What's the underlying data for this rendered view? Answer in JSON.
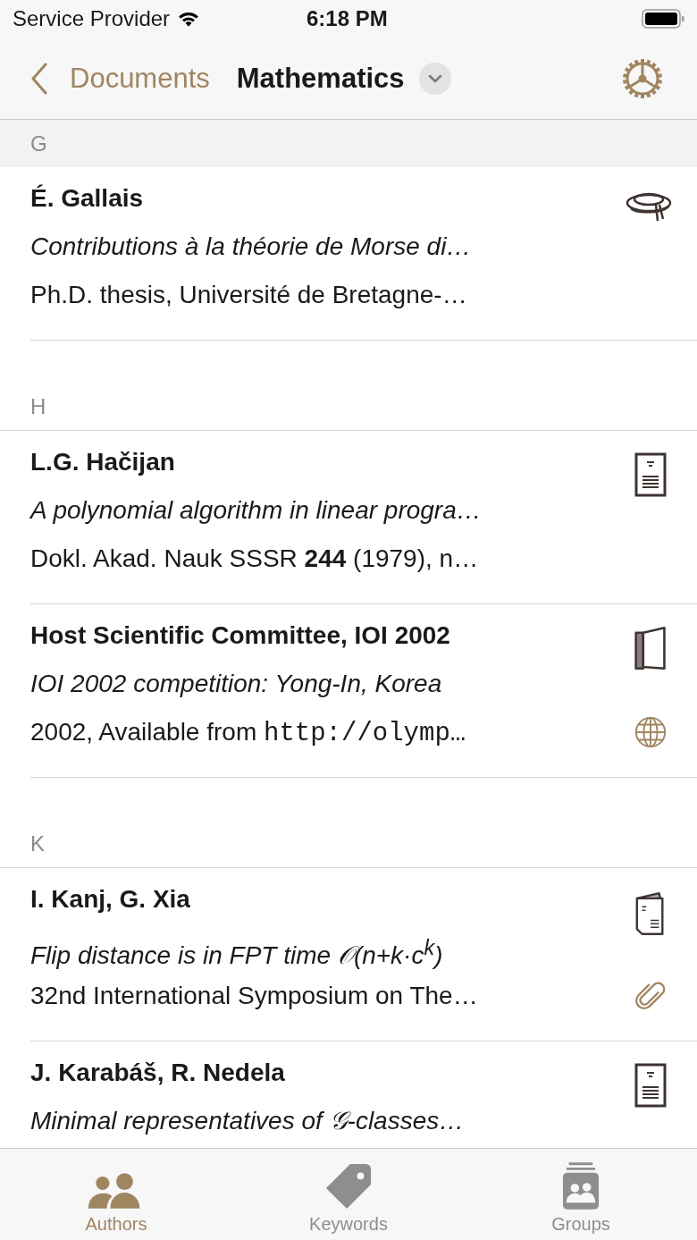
{
  "status_bar": {
    "carrier": "Service Provider",
    "time": "6:18 PM"
  },
  "nav": {
    "back": "Documents",
    "title": "Mathematics"
  },
  "sections": [
    {
      "letter": "G",
      "pinned": true,
      "rows": [
        {
          "author": "É. Gallais",
          "title": "Contributions à la théorie de Morse di…",
          "detail": [
            {
              "kind": "rich",
              "text": "Ph.D. thesis, Université de Bretagne-…"
            }
          ],
          "icons": [
            {
              "kind": "thesis"
            }
          ]
        }
      ]
    },
    {
      "letter": "H",
      "pinned": false,
      "rows": [
        {
          "author": "L.G. Hačijan",
          "title": "A polynomial algorithm in linear progra…",
          "detail": [
            {
              "kind": "rich",
              "text": "Dokl. Akad. Nauk SSSR **244** (1979), n…"
            }
          ],
          "icons": [
            {
              "kind": "article"
            }
          ]
        },
        {
          "author": "Host Scientific Committee, IOI 2002",
          "title": "IOI 2002 competition: Yong-In, Korea",
          "detail": [
            {
              "kind": "rich",
              "text": "2002, Available from "
            },
            {
              "kind": "mono",
              "text": "http://olymp…"
            }
          ],
          "icons": [
            {
              "kind": "book"
            },
            {
              "kind": "web"
            }
          ]
        }
      ]
    },
    {
      "letter": "K",
      "pinned": false,
      "rows": [
        {
          "author": "I. Kanj, G. Xia",
          "title": "Flip distance is in FPT time 𝒪(n+k·c$^{k}$)",
          "detail": [
            {
              "kind": "rich",
              "text": "32nd International Symposium on The…"
            }
          ],
          "icons": [
            {
              "kind": "booklet"
            },
            {
              "kind": "attachment"
            }
          ]
        },
        {
          "author": "J. Karabáš, R. Nedela",
          "title": "Minimal representatives of 𝒢-classes…",
          "icons": [
            {
              "kind": "article"
            }
          ]
        }
      ]
    }
  ],
  "tabs": [
    {
      "kind": "authors",
      "label": "Authors",
      "selected": true
    },
    {
      "kind": "keywords",
      "label": "Keywords",
      "selected": false
    },
    {
      "kind": "groups",
      "label": "Groups",
      "selected": false
    }
  ]
}
